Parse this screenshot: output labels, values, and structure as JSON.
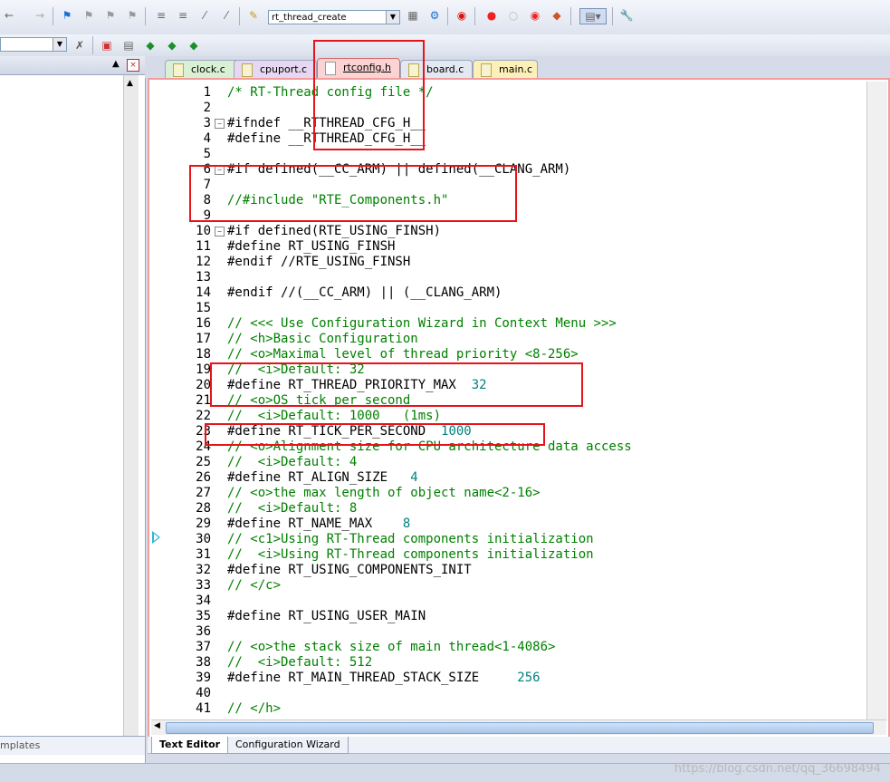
{
  "toolbar": {
    "function_combo": "rt_thread_create",
    "left_combo": ""
  },
  "tabs": [
    {
      "label": "clock.c"
    },
    {
      "label": "cpuport.c"
    },
    {
      "label": "rtconfig.h"
    },
    {
      "label": "board.c"
    },
    {
      "label": "main.c"
    }
  ],
  "left_panel": {
    "bottom_tab": "mplates"
  },
  "editor_tabs": {
    "text_editor": "Text Editor",
    "config_wizard": "Configuration Wizard"
  },
  "code_lines": [
    {
      "n": "1",
      "t": "/* RT-Thread config file */"
    },
    {
      "n": "2",
      "t": ""
    },
    {
      "n": "3",
      "t": "#ifndef __RTTHREAD_CFG_H__"
    },
    {
      "n": "4",
      "t": "#define __RTTHREAD_CFG_H__"
    },
    {
      "n": "5",
      "t": ""
    },
    {
      "n": "6",
      "t": "#if defined(__CC_ARM) || defined(__CLANG_ARM)"
    },
    {
      "n": "7",
      "t": ""
    },
    {
      "n": "8",
      "t": "//#include \"RTE_Components.h\""
    },
    {
      "n": "9",
      "t": ""
    },
    {
      "n": "10",
      "t": "#if defined(RTE_USING_FINSH)"
    },
    {
      "n": "11",
      "t": "#define RT_USING_FINSH"
    },
    {
      "n": "12",
      "t": "#endif //RTE_USING_FINSH"
    },
    {
      "n": "13",
      "t": ""
    },
    {
      "n": "14",
      "t": "#endif //(__CC_ARM) || (__CLANG_ARM)"
    },
    {
      "n": "15",
      "t": ""
    },
    {
      "n": "16",
      "t": "// <<< Use Configuration Wizard in Context Menu >>>"
    },
    {
      "n": "17",
      "t": "// <h>Basic Configuration"
    },
    {
      "n": "18",
      "t": "// <o>Maximal level of thread priority <8-256>"
    },
    {
      "n": "19",
      "t": "//  <i>Default: 32"
    },
    {
      "n": "20",
      "t": "#define RT_THREAD_PRIORITY_MAX  32"
    },
    {
      "n": "21",
      "t": "// <o>OS tick per second"
    },
    {
      "n": "22",
      "t": "//  <i>Default: 1000   (1ms)"
    },
    {
      "n": "23",
      "t": "#define RT_TICK_PER_SECOND  1000"
    },
    {
      "n": "24",
      "t": "// <o>Alignment size for CPU architecture data access"
    },
    {
      "n": "25",
      "t": "//  <i>Default: 4"
    },
    {
      "n": "26",
      "t": "#define RT_ALIGN_SIZE   4"
    },
    {
      "n": "27",
      "t": "// <o>the max length of object name<2-16>"
    },
    {
      "n": "28",
      "t": "//  <i>Default: 8"
    },
    {
      "n": "29",
      "t": "#define RT_NAME_MAX    8"
    },
    {
      "n": "30",
      "t": "// <c1>Using RT-Thread components initialization"
    },
    {
      "n": "31",
      "t": "//  <i>Using RT-Thread components initialization"
    },
    {
      "n": "32",
      "t": "#define RT_USING_COMPONENTS_INIT"
    },
    {
      "n": "33",
      "t": "// </c>"
    },
    {
      "n": "34",
      "t": ""
    },
    {
      "n": "35",
      "t": "#define RT_USING_USER_MAIN"
    },
    {
      "n": "36",
      "t": ""
    },
    {
      "n": "37",
      "t": "// <o>the stack size of main thread<1-4086>"
    },
    {
      "n": "38",
      "t": "//  <i>Default: 512"
    },
    {
      "n": "39",
      "t": "#define RT_MAIN_THREAD_STACK_SIZE     256"
    },
    {
      "n": "40",
      "t": ""
    },
    {
      "n": "41",
      "t": "// </h>"
    }
  ],
  "watermark": "https://blog.csdn.net/qq_36698494",
  "colors": {
    "comment": "#008000",
    "number": "#008080",
    "highlight": "#e8131a"
  }
}
